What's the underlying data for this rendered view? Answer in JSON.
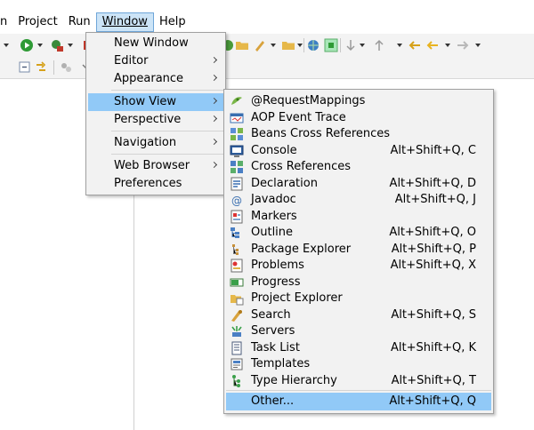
{
  "menubar": {
    "items": [
      {
        "label": "n"
      },
      {
        "label": "Project"
      },
      {
        "label": "Run"
      },
      {
        "label": "Window"
      },
      {
        "label": "Help"
      }
    ]
  },
  "window_menu": {
    "items": [
      {
        "label": "New Window"
      },
      {
        "label": "Editor"
      },
      {
        "label": "Appearance"
      },
      {
        "label": "Show View"
      },
      {
        "label": "Perspective"
      },
      {
        "label": "Navigation"
      },
      {
        "label": "Web Browser"
      },
      {
        "label": "Preferences"
      }
    ]
  },
  "show_view_menu": {
    "items": [
      {
        "label": "@RequestMappings",
        "shortcut": "",
        "icon": "request-mappings-icon"
      },
      {
        "label": "AOP Event Trace",
        "shortcut": "",
        "icon": "aop-trace-icon"
      },
      {
        "label": "Beans Cross References",
        "shortcut": "",
        "icon": "beans-xref-icon"
      },
      {
        "label": "Console",
        "shortcut": "Alt+Shift+Q, C",
        "icon": "console-icon"
      },
      {
        "label": "Cross References",
        "shortcut": "",
        "icon": "cross-references-icon"
      },
      {
        "label": "Declaration",
        "shortcut": "Alt+Shift+Q, D",
        "icon": "declaration-icon"
      },
      {
        "label": "Javadoc",
        "shortcut": "Alt+Shift+Q, J",
        "icon": "javadoc-icon"
      },
      {
        "label": "Markers",
        "shortcut": "",
        "icon": "markers-icon"
      },
      {
        "label": "Outline",
        "shortcut": "Alt+Shift+Q, O",
        "icon": "outline-icon"
      },
      {
        "label": "Package Explorer",
        "shortcut": "Alt+Shift+Q, P",
        "icon": "package-explorer-icon"
      },
      {
        "label": "Problems",
        "shortcut": "Alt+Shift+Q, X",
        "icon": "problems-icon"
      },
      {
        "label": "Progress",
        "shortcut": "",
        "icon": "progress-icon"
      },
      {
        "label": "Project Explorer",
        "shortcut": "",
        "icon": "project-explorer-icon"
      },
      {
        "label": "Search",
        "shortcut": "Alt+Shift+Q, S",
        "icon": "search-icon"
      },
      {
        "label": "Servers",
        "shortcut": "",
        "icon": "servers-icon"
      },
      {
        "label": "Task List",
        "shortcut": "Alt+Shift+Q, K",
        "icon": "task-list-icon"
      },
      {
        "label": "Templates",
        "shortcut": "",
        "icon": "templates-icon"
      },
      {
        "label": "Type Hierarchy",
        "shortcut": "Alt+Shift+Q, T",
        "icon": "type-hierarchy-icon"
      },
      {
        "label": "Other...",
        "shortcut": "Alt+Shift+Q, Q",
        "icon": ""
      }
    ]
  },
  "colors": {
    "menu_bg": "#f2f2f2",
    "highlight": "#91c9f7",
    "menubar_active": "#cce4f7"
  }
}
